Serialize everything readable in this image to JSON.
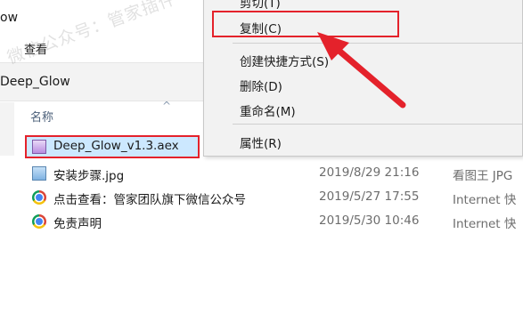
{
  "window": {
    "title_fragment": "ow",
    "ribbon_tab": "查看"
  },
  "address": {
    "path_fragment": "Deep_Glow"
  },
  "columns": {
    "name_header": "名称"
  },
  "files": [
    {
      "name": "Deep_Glow_v1.3.aex",
      "date": "",
      "type": "",
      "icon": "aex-file-icon"
    },
    {
      "name": "安装步骤.jpg",
      "date": "2019/8/29 21:16",
      "type": "看图王 JPG",
      "icon": "jpg-file-icon"
    },
    {
      "name": "点击查看：管家团队旗下微信公众号",
      "date": "2019/5/27 17:55",
      "type": "Internet 快",
      "icon": "chrome-icon"
    },
    {
      "name": "免责声明",
      "date": "2019/5/30 10:46",
      "type": "Internet 快",
      "icon": "chrome-icon"
    }
  ],
  "context_menu": {
    "items": [
      {
        "label": "剪切(T)"
      },
      {
        "label": "复制(C)"
      },
      {
        "label": "创建快捷方式(S)"
      },
      {
        "label": "删除(D)"
      },
      {
        "label": "重命名(M)"
      },
      {
        "label": "属性(R)"
      }
    ]
  },
  "watermark": "微信公众号：管家插件",
  "colors": {
    "highlight_red": "#e4222b",
    "selection_blue": "#cce8ff",
    "menu_bg": "#f2f2f2"
  }
}
